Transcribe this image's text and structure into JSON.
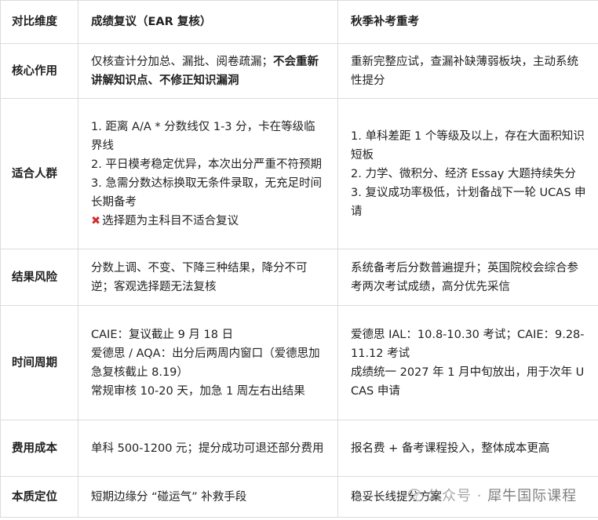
{
  "headers": [
    "对比维度",
    "成绩复议（EAR 复核）",
    "秋季补考重考"
  ],
  "rows": [
    {
      "label": "核心作用",
      "ear_text": "仅核查计分加总、漏批、阅卷疏漏；",
      "ear_bold": "不会重新讲解知识点、不修正知识漏洞",
      "resit": [
        "重新完整应试，查漏补缺薄弱板块，主动系统性提分"
      ]
    },
    {
      "label": "适合人群",
      "ear": [
        "1. 距离 A/A * 分数线仅 1-3 分，卡在等级临界线",
        "2. 平日模考稳定优异，本次出分严重不符预期",
        "3. 急需分数达标换取无条件录取，无充足时间长期备考"
      ],
      "ear_warning_icon": "✖",
      "ear_warning": "选择题为主科目不适合复议",
      "resit": [
        "1. 单科差距 1 个等级及以上，存在大面积知识短板",
        "2. 力学、微积分、经济 Essay 大题持续失分",
        "3. 复议成功率极低，计划备战下一轮 UCAS 申请"
      ]
    },
    {
      "label": "结果风险",
      "ear": [
        "分数上调、不变、下降三种结果，降分不可逆；客观选择题无法复核"
      ],
      "resit": [
        "系统备考后分数普遍提升；英国院校会综合参考两次考试成绩，高分优先采信"
      ]
    },
    {
      "label": "时间周期",
      "ear": [
        "CAIE：复议截止 9 月 18 日",
        "爱德思 / AQA：出分后两周内窗口（爱德思加急复核截止 8.19）",
        "常规审核 10-20 天，加急 1 周左右出结果"
      ],
      "resit": [
        "爱德思 IAL：10.8-10.30 考试；CAIE：9.28-11.12 考试",
        "成绩统一 2027 年 1 月中旬放出，用于次年 UCAS 申请"
      ]
    },
    {
      "label": "费用成本",
      "ear": [
        "单科 500-1200 元；提分成功可退还部分费用"
      ],
      "resit": [
        "报名费 + 备考课程投入，整体成本更高"
      ]
    },
    {
      "label": "本质定位",
      "ear": [
        "短期边缘分 “碰运气” 补救手段"
      ],
      "resit": [
        "稳妥长线提分方案"
      ]
    }
  ],
  "watermark": {
    "icon": "wechat-icon",
    "prefix": "公众号 ·",
    "brand": "犀牛国际课程"
  }
}
